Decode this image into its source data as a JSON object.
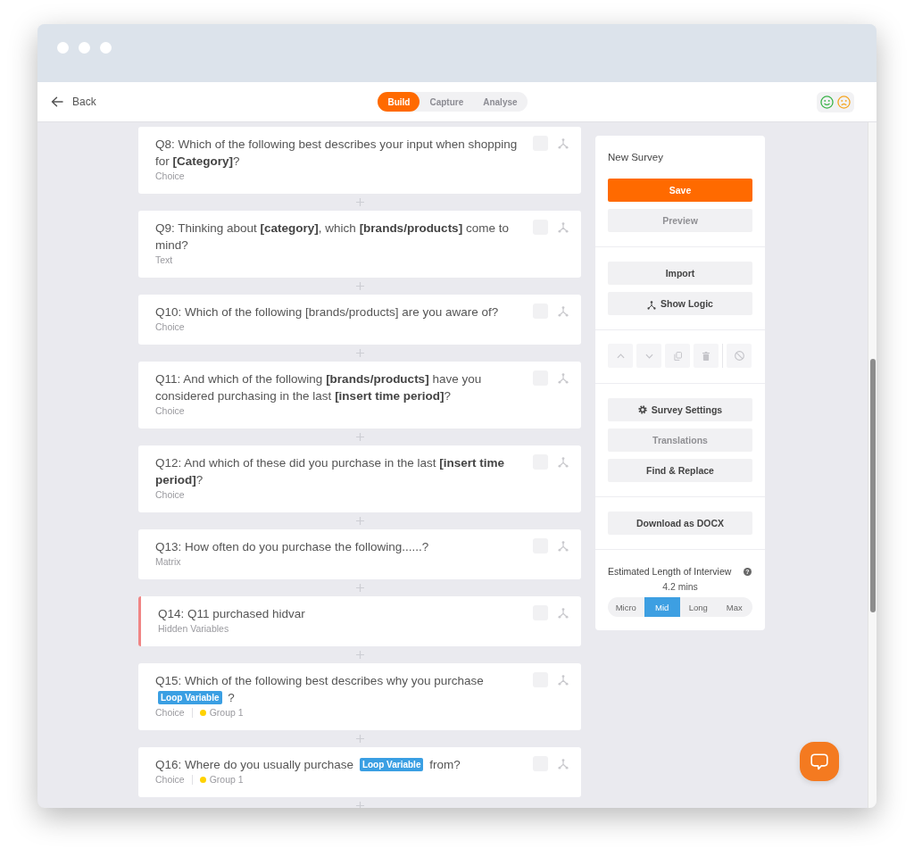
{
  "nav": {
    "back": "Back",
    "tabs": [
      {
        "label": "Build",
        "selected": true
      },
      {
        "label": "Capture",
        "selected": false
      },
      {
        "label": "Analyse",
        "selected": false
      }
    ]
  },
  "questions": [
    {
      "title": [
        {
          "kind": "text",
          "text": "Q8: Which of the following best describes your input when shopping for **[Category]**?"
        }
      ],
      "type": "Choice",
      "checked": false,
      "flagged": false
    },
    {
      "title": [
        {
          "kind": "text",
          "text": "Q9: Thinking about **[category]**, which **[brands/products]** come to mind?"
        }
      ],
      "type": "Text",
      "checked": false,
      "flagged": false
    },
    {
      "title": [
        {
          "kind": "text",
          "text": "Q10: Which of the following [brands/products] are you aware of?"
        }
      ],
      "type": "Choice",
      "checked": false,
      "flagged": false
    },
    {
      "title": [
        {
          "kind": "text",
          "text": "Q11: And which of the following **[brands/products]** have you considered purchasing in the last **[insert time period]**?"
        }
      ],
      "type": "Choice",
      "checked": false,
      "flagged": false
    },
    {
      "title": [
        {
          "kind": "text",
          "text": "Q12: And which of these did you purchase in the last **[insert time period]**?"
        }
      ],
      "type": "Choice",
      "checked": false,
      "flagged": false
    },
    {
      "title": [
        {
          "kind": "text",
          "text": "Q13: How often do you purchase the following......?"
        }
      ],
      "type": "Matrix",
      "checked": false,
      "flagged": false
    },
    {
      "title": [
        {
          "kind": "text",
          "text": "Q14: Q11 purchased hidvar"
        }
      ],
      "type": "Hidden Variables",
      "checked": false,
      "flagged": true
    },
    {
      "title": [
        {
          "kind": "text",
          "text": "Q15: Which of the following best describes why you purchase"
        },
        {
          "kind": "tag",
          "text": "Loop Variable"
        },
        {
          "kind": "text",
          "text": "?"
        }
      ],
      "type": "Choice",
      "group": {
        "label": "Group 1",
        "color": "#ffd200"
      },
      "checked": false,
      "flagged": false
    },
    {
      "title": [
        {
          "kind": "text",
          "text": "Q16: Where do you usually purchase"
        },
        {
          "kind": "tag",
          "text": "Loop Variable"
        },
        {
          "kind": "text",
          "text": "from?"
        }
      ],
      "type": "Choice",
      "group": {
        "label": "Group 1",
        "color": "#ffd200"
      },
      "checked": false,
      "flagged": false
    }
  ],
  "panel": {
    "title": "New Survey",
    "sections": [
      {
        "buttons": [
          {
            "label": "Save",
            "kind": "primary",
            "disabled": false
          },
          {
            "label": "Preview",
            "kind": "plain",
            "disabled": true
          }
        ]
      },
      {
        "buttons": [
          {
            "label": "Import",
            "kind": "plain",
            "disabled": false
          },
          {
            "label": "Show Logic",
            "kind": "logic",
            "disabled": false
          }
        ]
      },
      {
        "tools": [
          {
            "kind": "up",
            "disabled": true
          },
          {
            "kind": "down",
            "disabled": true
          },
          {
            "kind": "copy",
            "disabled": true
          },
          {
            "kind": "delete",
            "disabled": true
          },
          {
            "kind": "block",
            "disabled": true
          }
        ]
      },
      {
        "buttons": [
          {
            "label": "Survey Settings",
            "kind": "settings",
            "disabled": false
          },
          {
            "label": "Translations",
            "kind": "plain",
            "disabled": true
          },
          {
            "label": "Find & Replace",
            "kind": "plain",
            "disabled": false
          }
        ]
      },
      {
        "buttons": [
          {
            "label": "Download as DOCX",
            "kind": "plain",
            "disabled": false
          }
        ]
      }
    ],
    "estimate": {
      "label": "Estimated Length of Interview",
      "help": "?",
      "value": "4.2 mins",
      "options": [
        {
          "label": "Micro",
          "selected": false
        },
        {
          "label": "Mid",
          "selected": true
        },
        {
          "label": "Long",
          "selected": false
        },
        {
          "label": "Max",
          "selected": false
        }
      ]
    }
  }
}
